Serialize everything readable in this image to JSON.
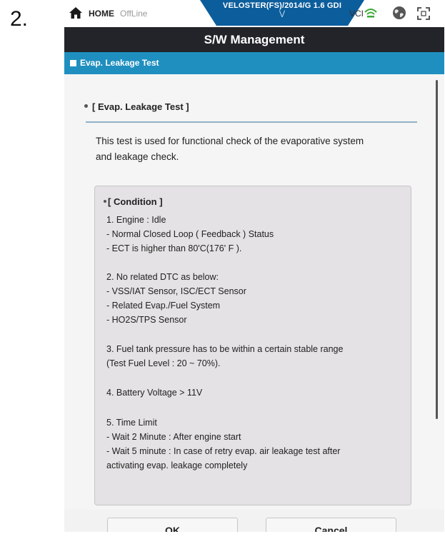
{
  "step_label": "2.",
  "status_bar": {
    "home_label": "HOME",
    "offline_label": "OffLine",
    "vehicle": "VELOSTER(FS)/2014/G 1.6 GDI",
    "vci_label": "VCI",
    "icons": [
      "home-icon",
      "vci-wifi-icon",
      "globe-icon",
      "fullscreen-icon"
    ]
  },
  "header": {
    "title": "S/W Management",
    "section": "Evap. Leakage Test"
  },
  "content": {
    "heading": "[ Evap. Leakage Test ]",
    "description_lines": [
      "This test is used for functional check of the evaporative system",
      "and leakage check."
    ],
    "condition": {
      "heading": "[ Condition ]",
      "lines": [
        "1. Engine : Idle",
        "- Normal Closed Loop ( Feedback ) Status",
        "- ECT is higher than 80'C(176' F ).",
        "2. No related DTC as below:",
        "- VSS/IAT Sensor, ISC/ECT Sensor",
        "- Related Evap./Fuel System",
        "- HO2S/TPS Sensor",
        "3. Fuel tank pressure has to be within a certain stable range",
        "(Test Fuel Level : 20 ~ 70%).",
        "4. Battery Voltage > 11V",
        "5. Time Limit",
        "- Wait 2 Minute : After engine start",
        "- Wait 5 minute : In case of retry evap. air leakage test after",
        "activating evap. leakage completely"
      ]
    }
  },
  "footer": {
    "ok_label": "OK",
    "cancel_label": "Cancel"
  },
  "colors": {
    "title_bar": "#222429",
    "section_bar": "#1f8fbf",
    "vehicle_tab": "#0c5d9c"
  }
}
